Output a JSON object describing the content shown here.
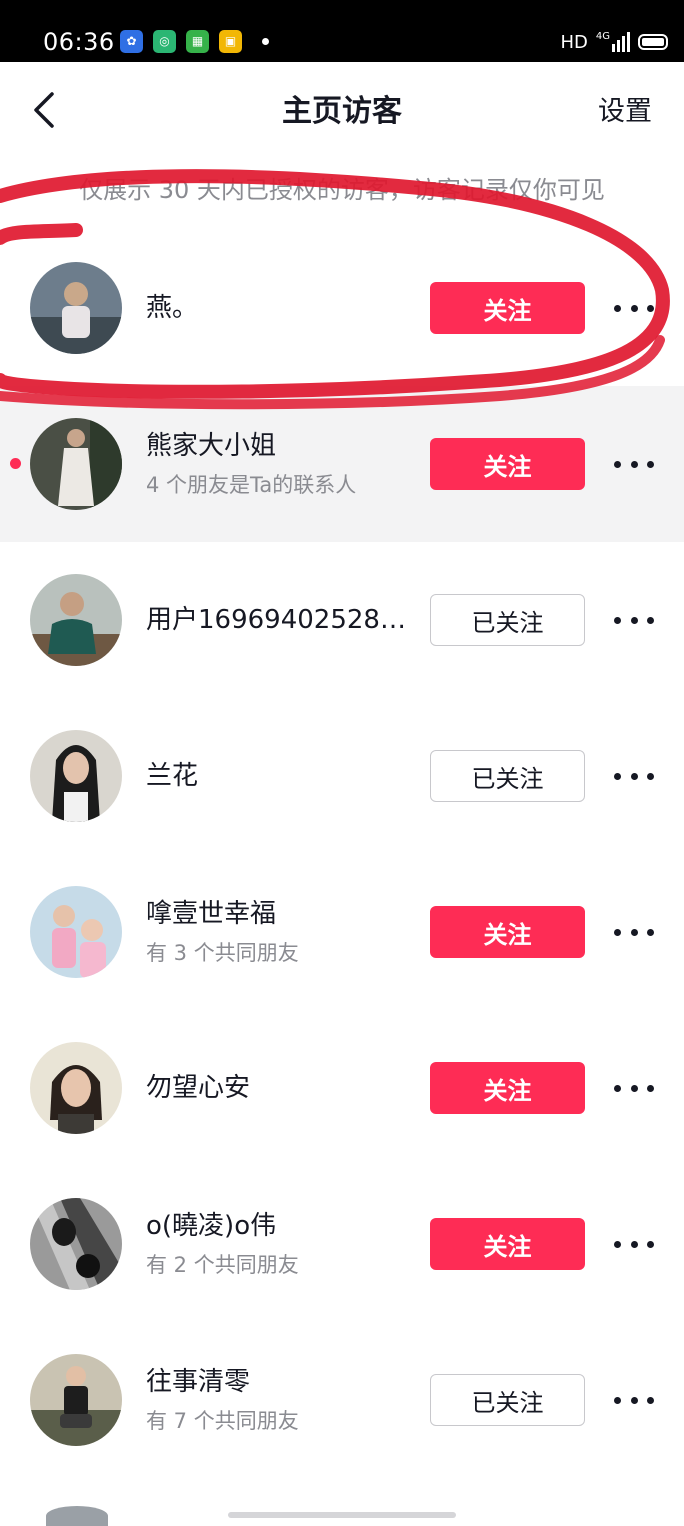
{
  "status_bar": {
    "time": "06:36",
    "network": "HD",
    "signal": "4G"
  },
  "nav": {
    "title": "主页访客",
    "settings_label": "设置"
  },
  "notice": "仅展示 30 天内已授权的访客，访客记录仅你可见",
  "colors": {
    "accent": "#fe2c55",
    "annotation": "#e0182f"
  },
  "visitors": [
    {
      "name": "燕。",
      "subtitle": "",
      "button": "关注",
      "followed": false,
      "unread": false
    },
    {
      "name": "熊家大小姐",
      "subtitle": "4 个朋友是Ta的联系人",
      "button": "关注",
      "followed": false,
      "unread": true
    },
    {
      "name": "用户16969402528…",
      "subtitle": "",
      "button": "已关注",
      "followed": true,
      "unread": false
    },
    {
      "name": "兰花",
      "subtitle": "",
      "button": "已关注",
      "followed": true,
      "unread": false
    },
    {
      "name": "嗱壹世幸福",
      "subtitle": "有 3 个共同朋友",
      "button": "关注",
      "followed": false,
      "unread": false
    },
    {
      "name": "勿望心安",
      "subtitle": "",
      "button": "关注",
      "followed": false,
      "unread": false
    },
    {
      "name": "o(曉凌)o伟",
      "subtitle": "有 2 个共同朋友",
      "button": "关注",
      "followed": false,
      "unread": false
    },
    {
      "name": "往事清零",
      "subtitle": "有 7 个共同朋友",
      "button": "已关注",
      "followed": true,
      "unread": false
    }
  ]
}
